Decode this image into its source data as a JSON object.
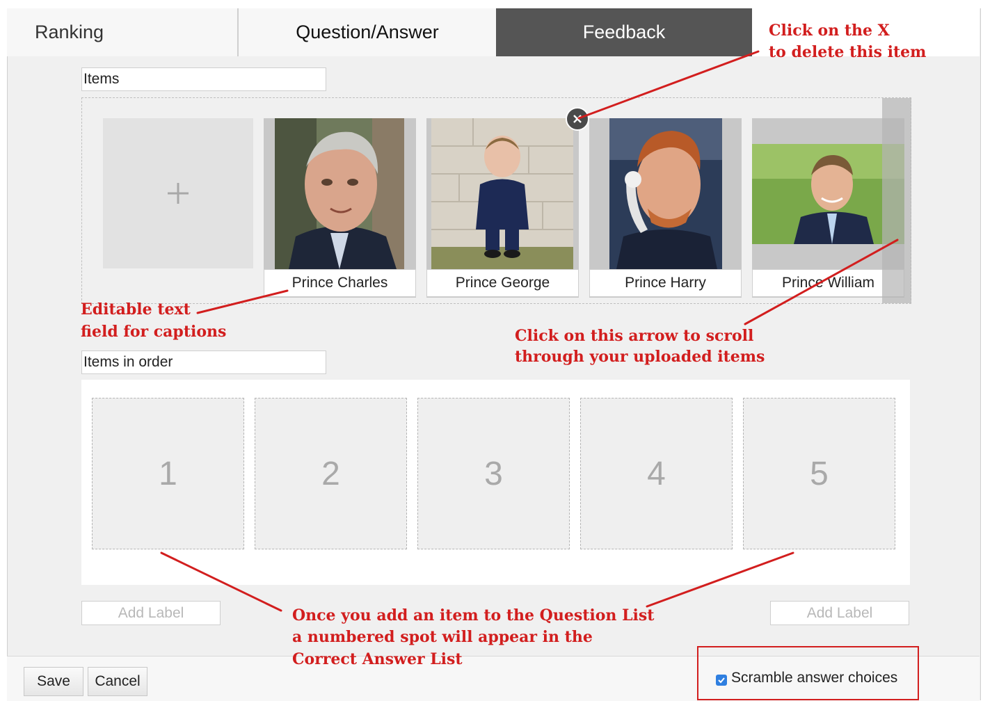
{
  "tabs": {
    "ranking": "Ranking",
    "question_answer": "Question/Answer",
    "feedback": "Feedback"
  },
  "items_section": {
    "title_value": "Items",
    "add_icon": "plus-icon",
    "items": [
      {
        "caption": "Prince Charles"
      },
      {
        "caption": "Prince George"
      },
      {
        "caption": "Prince Harry"
      },
      {
        "caption": "Prince William"
      }
    ]
  },
  "order_section": {
    "title_value": "Items in order",
    "slots": [
      "1",
      "2",
      "3",
      "4",
      "5"
    ],
    "add_label_left": "Add Label",
    "add_label_right": "Add Label"
  },
  "footer": {
    "save": "Save",
    "cancel": "Cancel",
    "scramble_label": "Scramble answer choices",
    "scramble_checked": true
  },
  "annotations": {
    "delete_x": [
      "Click on the X",
      "to delete this item"
    ],
    "captions": [
      "Editable text",
      "field for captions"
    ],
    "scroll": [
      "Click on this arrow to scroll",
      "through your uploaded items"
    ],
    "numbered": [
      "Once you add an item to the Question List",
      "a numbered spot will appear in the",
      "Correct Answer List"
    ]
  },
  "colors": {
    "annotation_red": "#d21e1e",
    "active_tab": "#555555",
    "checkbox_blue": "#2f7fe0"
  }
}
